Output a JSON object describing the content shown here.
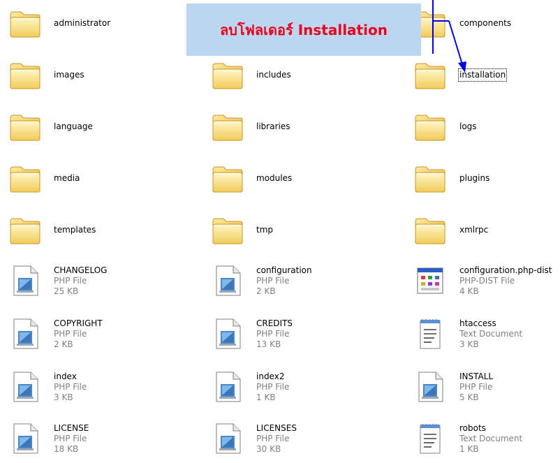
{
  "annotation": {
    "text": "ลบโฟลเดอร์ Installation",
    "color": "#e8001c",
    "background": "#bcd6f0",
    "arrow_color": "#0000e0"
  },
  "folders": {
    "administrator": "administrator",
    "components": "components",
    "images": "images",
    "includes": "includes",
    "installation": "installation",
    "language": "language",
    "libraries": "libraries",
    "logs": "logs",
    "media": "media",
    "modules": "modules",
    "plugins": "plugins",
    "templates": "templates",
    "tmp": "tmp",
    "xmlrpc": "xmlrpc"
  },
  "files": {
    "changelog": {
      "name": "CHANGELOG",
      "type": "PHP File",
      "size": "25 KB",
      "icon": "php-file-icon"
    },
    "configuration": {
      "name": "configuration",
      "type": "PHP File",
      "size": "2 KB",
      "icon": "php-file-icon"
    },
    "config_dist": {
      "name": "configuration.php-dist",
      "type": "PHP-DIST File",
      "size": "4 KB",
      "icon": "app-window-icon"
    },
    "copyright": {
      "name": "COPYRIGHT",
      "type": "PHP File",
      "size": "2 KB",
      "icon": "php-file-icon"
    },
    "credits": {
      "name": "CREDITS",
      "type": "PHP File",
      "size": "13 KB",
      "icon": "php-file-icon"
    },
    "htaccess": {
      "name": "htaccess",
      "type": "Text Document",
      "size": "3 KB",
      "icon": "text-document-icon"
    },
    "index": {
      "name": "index",
      "type": "PHP File",
      "size": "3 KB",
      "icon": "php-file-icon"
    },
    "index2": {
      "name": "index2",
      "type": "PHP File",
      "size": "1 KB",
      "icon": "php-file-icon"
    },
    "install": {
      "name": "INSTALL",
      "type": "PHP File",
      "size": "5 KB",
      "icon": "php-file-icon"
    },
    "license": {
      "name": "LICENSE",
      "type": "PHP File",
      "size": "18 KB",
      "icon": "php-file-icon"
    },
    "licenses": {
      "name": "LICENSES",
      "type": "PHP File",
      "size": "30 KB",
      "icon": "php-file-icon"
    },
    "robots": {
      "name": "robots",
      "type": "Text Document",
      "size": "1 KB",
      "icon": "text-document-icon"
    }
  }
}
